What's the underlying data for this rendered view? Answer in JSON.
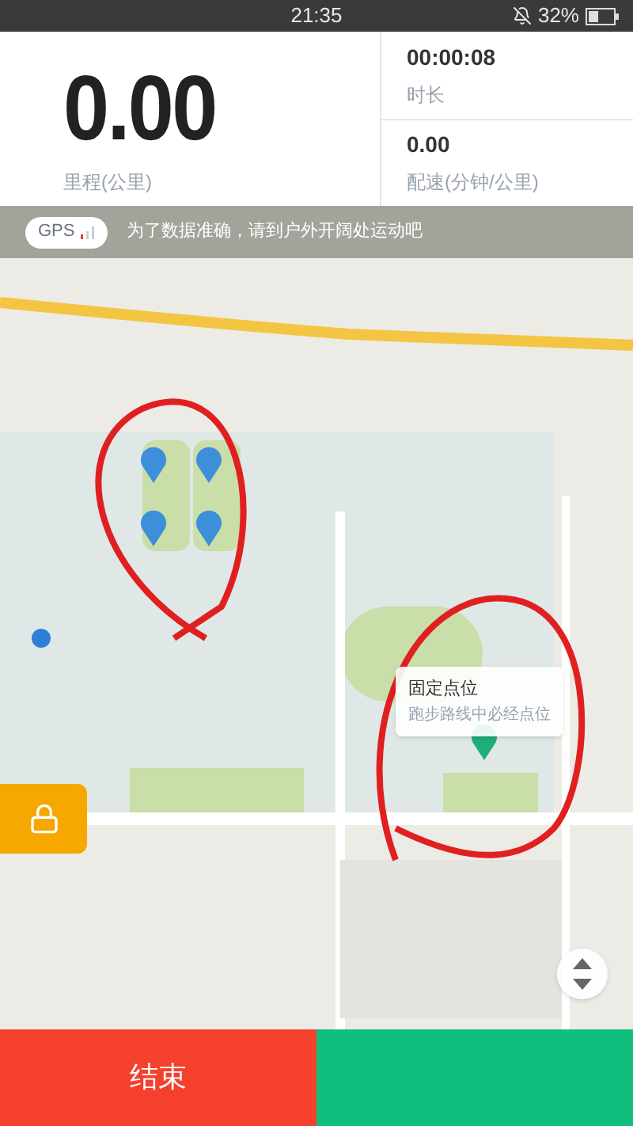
{
  "status_bar": {
    "time": "21:35",
    "battery": "32%"
  },
  "stats": {
    "distance": {
      "value": "0.00",
      "label": "里程(公里)"
    },
    "duration": {
      "value": "00:00:08",
      "label": "时长"
    },
    "pace": {
      "value": "0.00",
      "label": "配速(分钟/公里)"
    }
  },
  "notice": {
    "badge": "GPS",
    "text": "为了数据准确，请到户外开阔处运动吧"
  },
  "map": {
    "kind": "picture",
    "popup": {
      "title": "固定点位",
      "subtitle": "跑步路线中必经点位"
    }
  },
  "bottom": {
    "end_button": "结束"
  }
}
